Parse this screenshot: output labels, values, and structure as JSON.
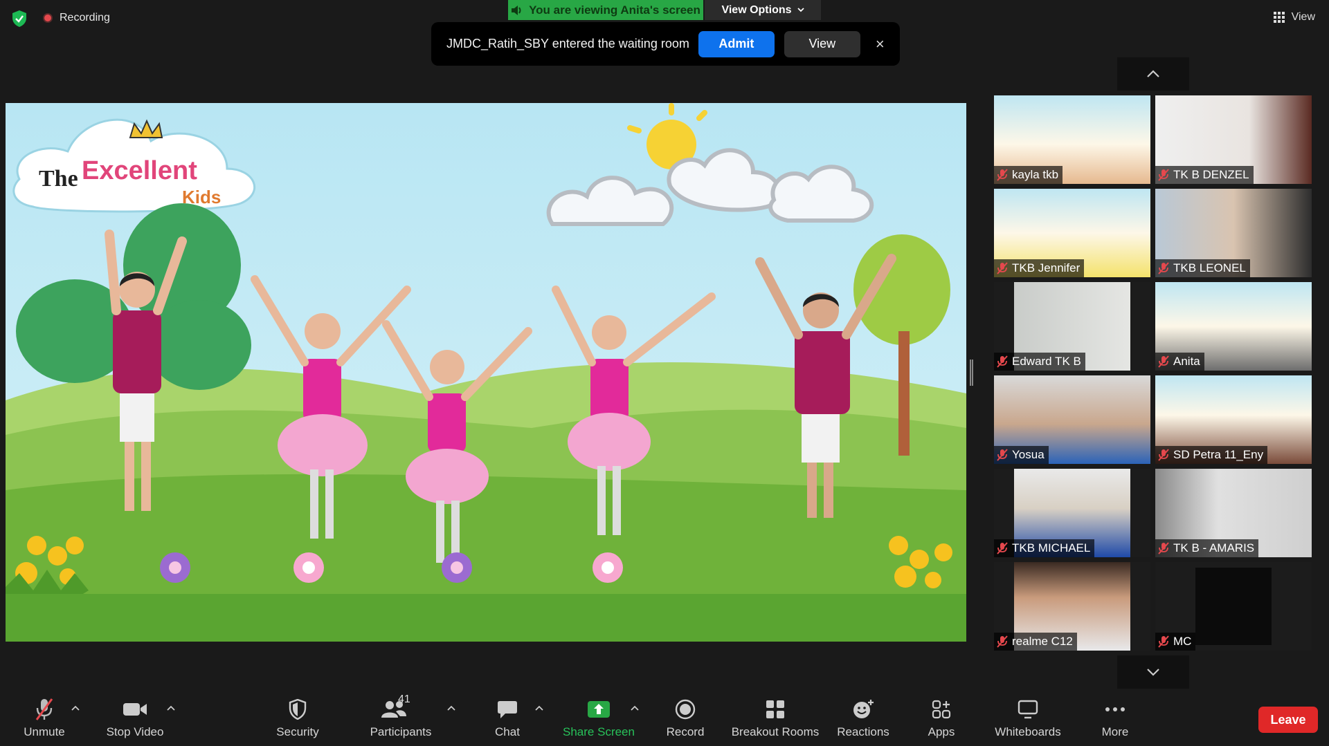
{
  "top_bar": {
    "recording_label": "Recording",
    "viewing_banner": "You are viewing Anita's screen",
    "view_options_label": "View Options",
    "view_label": "View"
  },
  "notification": {
    "message": "JMDC_Ratih_SBY entered the waiting room",
    "admit_label": "Admit",
    "view_label": "View",
    "close_glyph": "×"
  },
  "shared_screen": {
    "logo_text": "The Excellent Kids"
  },
  "participants": [
    {
      "name": "kayla tkb"
    },
    {
      "name": "TK B DENZEL"
    },
    {
      "name": "TKB Jennifer"
    },
    {
      "name": "TKB LEONEL"
    },
    {
      "name": "Edward TK B"
    },
    {
      "name": "Anita"
    },
    {
      "name": "Yosua"
    },
    {
      "name": "SD Petra 11_Eny"
    },
    {
      "name": "TKB MICHAEL"
    },
    {
      "name": "TK B - AMARIS"
    },
    {
      "name": "realme C12"
    },
    {
      "name": "MC"
    }
  ],
  "toolbar": {
    "unmute": "Unmute",
    "stop_video": "Stop Video",
    "security": "Security",
    "participants": "Participants",
    "participants_count": "41",
    "chat": "Chat",
    "share_screen": "Share Screen",
    "record": "Record",
    "breakout_rooms": "Breakout Rooms",
    "reactions": "Reactions",
    "apps": "Apps",
    "whiteboards": "Whiteboards",
    "more": "More",
    "leave": "Leave"
  },
  "colors": {
    "share_green": "#28a745",
    "admit_blue": "#0e72ed",
    "leave_red": "#e02828",
    "muted_red": "#e5484d"
  }
}
